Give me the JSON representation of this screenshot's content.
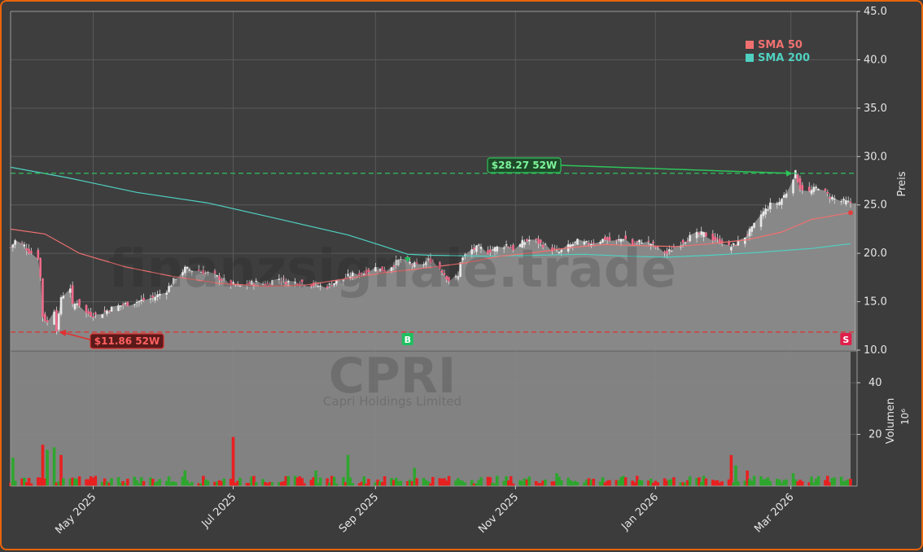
{
  "chart_data": {
    "type": "candlestick",
    "ticker": "CPRI",
    "company": "Capri Holdings Limited",
    "watermark": "CPRI",
    "watermark_site": "finanzsignale.trade",
    "price_axis": {
      "label": "Preis",
      "ylim": [
        10,
        45
      ],
      "ticks": [
        10.0,
        15.0,
        20.0,
        25.0,
        30.0,
        35.0,
        40.0,
        45.0
      ],
      "tick_labels": [
        "10.0",
        "15.0",
        "20.0",
        "25.0",
        "30.0",
        "35.0",
        "40.0",
        "45.0"
      ]
    },
    "volume_axis": {
      "label": "Volumen",
      "unit": "10⁶",
      "ylim": [
        0,
        52
      ],
      "ticks": [
        20,
        40
      ],
      "tick_labels": [
        "20",
        "40"
      ]
    },
    "x_axis": {
      "start": "2025-03-26",
      "end": "2026-03-27",
      "ticks": [
        "2025-05-01",
        "2025-07-01",
        "2025-09-01",
        "2025-11-01",
        "2026-01-01",
        "2026-03-01"
      ],
      "tick_labels": [
        "May 2025",
        "Jul 2025",
        "Sep 2025",
        "Nov 2025",
        "Jan 2026",
        "Mar 2026"
      ]
    },
    "legend": {
      "placement": "top-right",
      "items": [
        {
          "label": "SMA 50",
          "color": "#f07070"
        },
        {
          "label": "SMA 200",
          "color": "#4fd0c0"
        }
      ]
    },
    "price_path": [
      [
        "2025-03-26",
        20.6
      ],
      [
        "2025-03-28",
        21.3
      ],
      [
        "2025-04-01",
        20.8
      ],
      [
        "2025-04-03",
        20.2
      ],
      [
        "2025-04-07",
        19.6
      ],
      [
        "2025-04-08",
        17.5
      ],
      [
        "2025-04-09",
        13.5
      ],
      [
        "2025-04-11",
        12.8
      ],
      [
        "2025-04-14",
        14.2
      ],
      [
        "2025-04-15",
        12.2
      ],
      [
        "2025-04-16",
        13.5
      ],
      [
        "2025-04-17",
        15.5
      ],
      [
        "2025-04-21",
        16.5
      ],
      [
        "2025-04-22",
        14.5
      ],
      [
        "2025-04-24",
        15.0
      ],
      [
        "2025-04-28",
        13.8
      ],
      [
        "2025-05-02",
        13.6
      ],
      [
        "2025-05-06",
        14.0
      ],
      [
        "2025-05-09",
        14.3
      ],
      [
        "2025-05-14",
        14.7
      ],
      [
        "2025-05-20",
        15.0
      ],
      [
        "2025-05-27",
        15.4
      ],
      [
        "2025-06-02",
        16.2
      ],
      [
        "2025-06-06",
        17.5
      ],
      [
        "2025-06-10",
        18.4
      ],
      [
        "2025-06-16",
        18.2
      ],
      [
        "2025-06-22",
        17.8
      ],
      [
        "2025-06-26",
        17.3
      ],
      [
        "2025-06-30",
        16.8
      ],
      [
        "2025-07-04",
        16.6
      ],
      [
        "2025-07-10",
        17.0
      ],
      [
        "2025-07-16",
        16.8
      ],
      [
        "2025-07-20",
        17.5
      ],
      [
        "2025-07-24",
        17.1
      ],
      [
        "2025-07-30",
        17.0
      ],
      [
        "2025-08-04",
        16.8
      ],
      [
        "2025-08-10",
        16.5
      ],
      [
        "2025-08-16",
        17.2
      ],
      [
        "2025-08-22",
        17.8
      ],
      [
        "2025-08-27",
        18.0
      ],
      [
        "2025-09-01",
        18.5
      ],
      [
        "2025-09-05",
        18.2
      ],
      [
        "2025-09-08",
        18.7
      ],
      [
        "2025-09-12",
        19.4
      ],
      [
        "2025-09-16",
        19.0
      ],
      [
        "2025-09-20",
        18.6
      ],
      [
        "2025-09-24",
        19.3
      ],
      [
        "2025-09-26",
        19.2
      ],
      [
        "2025-09-30",
        18.2
      ],
      [
        "2025-10-03",
        17.2
      ],
      [
        "2025-10-07",
        17.6
      ],
      [
        "2025-10-08",
        19.2
      ],
      [
        "2025-10-12",
        20.3
      ],
      [
        "2025-10-16",
        20.6
      ],
      [
        "2025-10-20",
        20.2
      ],
      [
        "2025-10-24",
        20.6
      ],
      [
        "2025-10-28",
        20.9
      ],
      [
        "2025-11-01",
        20.3
      ],
      [
        "2025-11-04",
        21.1
      ],
      [
        "2025-11-08",
        21.5
      ],
      [
        "2025-11-12",
        21.0
      ],
      [
        "2025-11-16",
        20.5
      ],
      [
        "2025-11-20",
        20.1
      ],
      [
        "2025-11-24",
        20.7
      ],
      [
        "2025-11-28",
        21.2
      ],
      [
        "2025-12-02",
        21.0
      ],
      [
        "2025-12-06",
        21.2
      ],
      [
        "2025-12-10",
        21.5
      ],
      [
        "2025-12-14",
        21.1
      ],
      [
        "2025-12-18",
        21.6
      ],
      [
        "2025-12-22",
        20.9
      ],
      [
        "2025-12-26",
        21.3
      ],
      [
        "2025-12-30",
        21.0
      ],
      [
        "2026-01-03",
        20.3
      ],
      [
        "2026-01-06",
        20.0
      ],
      [
        "2026-01-10",
        20.8
      ],
      [
        "2026-01-14",
        21.4
      ],
      [
        "2026-01-18",
        21.9
      ],
      [
        "2026-01-22",
        22.0
      ],
      [
        "2026-01-26",
        21.5
      ],
      [
        "2026-01-30",
        21.2
      ],
      [
        "2026-02-02",
        20.6
      ],
      [
        "2026-02-04",
        20.8
      ],
      [
        "2026-02-08",
        21.5
      ],
      [
        "2026-02-12",
        22.5
      ],
      [
        "2026-02-16",
        24.0
      ],
      [
        "2026-02-20",
        25.0
      ],
      [
        "2026-02-24",
        25.3
      ],
      [
        "2026-02-27",
        26.3
      ],
      [
        "2026-03-01",
        27.5
      ],
      [
        "2026-03-03",
        28.3
      ],
      [
        "2026-03-05",
        26.8
      ],
      [
        "2026-03-09",
        26.3
      ],
      [
        "2026-03-13",
        26.9
      ],
      [
        "2026-03-17",
        26.0
      ],
      [
        "2026-03-21",
        25.5
      ],
      [
        "2026-03-27",
        25.2
      ]
    ],
    "sma200": [
      [
        "2025-03-26",
        28.9
      ],
      [
        "2025-04-20",
        27.8
      ],
      [
        "2025-05-20",
        26.3
      ],
      [
        "2025-06-20",
        25.2
      ],
      [
        "2025-07-20",
        23.6
      ],
      [
        "2025-08-20",
        21.9
      ],
      [
        "2025-09-05",
        20.7
      ],
      [
        "2025-09-15",
        19.9
      ],
      [
        "2025-09-25",
        19.8
      ],
      [
        "2025-10-20",
        19.7
      ],
      [
        "2025-11-10",
        19.8
      ],
      [
        "2025-12-01",
        19.9
      ],
      [
        "2025-12-20",
        19.7
      ],
      [
        "2026-01-05",
        19.6
      ],
      [
        "2026-01-25",
        19.8
      ],
      [
        "2026-02-15",
        20.1
      ],
      [
        "2026-03-10",
        20.5
      ],
      [
        "2026-03-27",
        21.0
      ]
    ],
    "sma50": [
      [
        "2025-03-26",
        22.5
      ],
      [
        "2025-04-10",
        22.0
      ],
      [
        "2025-04-25",
        20.0
      ],
      [
        "2025-05-15",
        18.6
      ],
      [
        "2025-06-05",
        17.6
      ],
      [
        "2025-06-25",
        16.9
      ],
      [
        "2025-07-15",
        16.6
      ],
      [
        "2025-08-01",
        16.7
      ],
      [
        "2025-08-20",
        17.4
      ],
      [
        "2025-09-05",
        18.0
      ],
      [
        "2025-09-20",
        18.4
      ],
      [
        "2025-10-10",
        19.0
      ],
      [
        "2025-10-25",
        19.7
      ],
      [
        "2025-11-10",
        20.1
      ],
      [
        "2025-11-25",
        20.6
      ],
      [
        "2025-12-10",
        20.9
      ],
      [
        "2025-12-25",
        20.8
      ],
      [
        "2026-01-10",
        20.7
      ],
      [
        "2026-01-25",
        21.0
      ],
      [
        "2026-02-10",
        21.4
      ],
      [
        "2026-02-25",
        22.2
      ],
      [
        "2026-03-10",
        23.5
      ],
      [
        "2026-03-27",
        24.2
      ]
    ],
    "annotations": [
      {
        "label": "$28.27 52W",
        "type": "52w-high",
        "date": "2026-03-03",
        "value": 28.27,
        "color": "#2ec45a"
      },
      {
        "label": "$11.86 52W",
        "type": "52w-low",
        "date": "2025-04-15",
        "value": 11.86,
        "color": "#e03030"
      }
    ],
    "signals": [
      {
        "label": "B",
        "date": "2025-09-15",
        "type": "buy",
        "color": "#1ec060"
      },
      {
        "label": "S",
        "date": "2026-03-25",
        "type": "sell",
        "color": "#e0204a"
      }
    ],
    "volume_spikes": [
      {
        "date": "2025-04-09",
        "value": 16,
        "up": false
      },
      {
        "date": "2025-04-11",
        "value": 14,
        "up": true
      },
      {
        "date": "2025-04-14",
        "value": 15,
        "up": true
      },
      {
        "date": "2025-04-17",
        "value": 12,
        "up": false
      },
      {
        "date": "2025-03-27",
        "value": 11,
        "up": true
      },
      {
        "date": "2025-07-01",
        "value": 19,
        "up": false
      },
      {
        "date": "2025-06-10",
        "value": 6,
        "up": true
      },
      {
        "date": "2025-08-06",
        "value": 6,
        "up": true
      },
      {
        "date": "2025-08-20",
        "value": 12,
        "up": true
      },
      {
        "date": "2025-09-18",
        "value": 7,
        "up": true
      },
      {
        "date": "2025-11-19",
        "value": 5,
        "up": true
      },
      {
        "date": "2025-12-13",
        "value": 5,
        "up": true
      },
      {
        "date": "2026-02-03",
        "value": 12,
        "up": false
      },
      {
        "date": "2026-02-05",
        "value": 8,
        "up": true
      },
      {
        "date": "2026-02-10",
        "value": 6,
        "up": false
      },
      {
        "date": "2026-03-02",
        "value": 5,
        "up": true
      }
    ],
    "colors": {
      "up": "#2ea62e",
      "down": "#e82020",
      "area": "#8c8c8c",
      "high": "#2ec45a",
      "low": "#e03030"
    }
  }
}
